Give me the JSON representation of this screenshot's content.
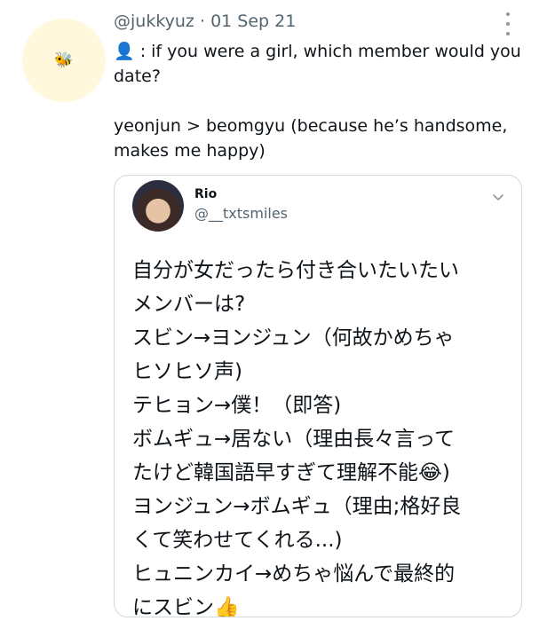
{
  "tweet": {
    "handle": "@jukkyuz",
    "separator": "·",
    "date": "01 Sep 21",
    "avatar_icon": "bee-icon",
    "lines": [
      "👤 : if you were a girl, which member would you",
      "date?",
      "yeonjun > beomgyu (because he’s handsome,",
      "makes me happy)"
    ]
  },
  "quoted": {
    "name": "Rio",
    "handle": "@__txtsmiles",
    "lines": [
      "自分が女だったら付き合いたいたい",
      "メンバーは?",
      "スビン→ヨンジュン（何故かめちゃ",
      "ヒソヒソ声)",
      "テヒョン→僕！（即答)",
      "ボムギュ→居ない（理由長々言って",
      "たけど韓国語早すぎて理解不能😂)",
      "ヨンジュン→ボムギュ（理由;格好良",
      "くて笑わせてくれる...)",
      "ヒュニンカイ→めちゃ悩んで最終的",
      "にスビン👍"
    ]
  },
  "colors": {
    "text": "#0f1419",
    "muted": "#536471",
    "border": "#cfd9de",
    "avatar_bg": "#fff8dc"
  }
}
